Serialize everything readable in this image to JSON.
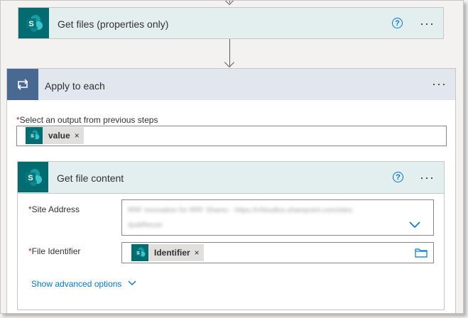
{
  "get_files": {
    "title": "Get files (properties only)"
  },
  "apply_to_each": {
    "title": "Apply to each",
    "select_label": "Select an output from previous steps",
    "token_value": "value"
  },
  "get_file_content": {
    "title": "Get file content",
    "site_address_label": "Site Address",
    "site_address_value_line1": "RRF Innovation for RRF Sharec - https://rrfstudios.sharepoint.com/sites",
    "site_address_value_line2": "/pubRecon",
    "file_identifier_label": "File Identifier",
    "file_identifier_token": "Identifier",
    "show_advanced": "Show advanced options"
  },
  "common": {
    "help": "?",
    "more": "···",
    "required_mark": "*",
    "remove": "×"
  },
  "colors": {
    "sharepoint": "#036c70",
    "loop": "#486991",
    "accent": "#0078d4"
  },
  "icons": [
    "sharepoint-icon",
    "loop-icon",
    "help-icon",
    "more-icon",
    "close-icon",
    "chevron-down-icon",
    "folder-icon"
  ]
}
